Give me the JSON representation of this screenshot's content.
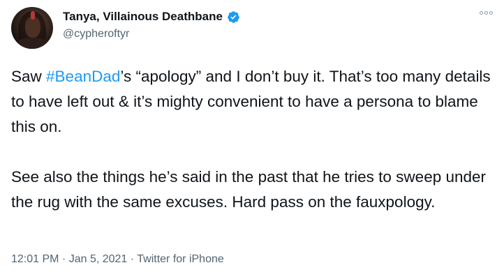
{
  "author": {
    "display_name": "Tanya, Villainous Deathbane",
    "handle": "@cypheroftyr",
    "verified_icon": "verified-badge-icon"
  },
  "tweet": {
    "text_before_hashtag": "Saw ",
    "hashtag": "#BeanDad",
    "text_after_hashtag": "’s “apology” and I don’t buy it. That’s too many details to have left out & it’s mighty convenient to have a persona to blame this on.\n\nSee also the things he’s said in the past that he tries to sweep under the rug with the same excuses. Hard pass on the fauxpology."
  },
  "meta": {
    "time": "12:01 PM",
    "date": "Jan 5, 2021",
    "source": "Twitter for iPhone",
    "separator": " · "
  },
  "colors": {
    "link": "#1d9bf0",
    "text": "#0f1419",
    "secondary": "#536471"
  },
  "icons": {
    "more": "more-options-icon"
  }
}
